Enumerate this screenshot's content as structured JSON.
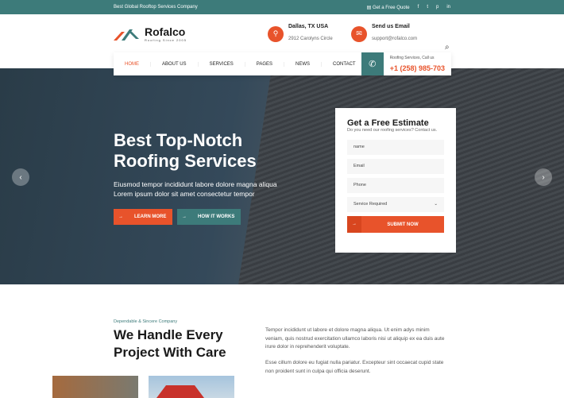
{
  "topbar": {
    "tagline": "Best Global Rooftop Services Company",
    "quote": "Get a Free Quote",
    "social": [
      "f",
      "t",
      "p",
      "in"
    ]
  },
  "logo": {
    "name": "Rofalco",
    "tag": "Roofing Since 2005"
  },
  "header": {
    "location_title": "Dallas, TX USA",
    "location_sub": "2912 Carolyns Circle",
    "email_title": "Send us Email",
    "email_sub": "support@rofalco.com"
  },
  "nav": {
    "items": [
      "HOME",
      "ABOUT US",
      "SERVICES",
      "PAGES",
      "NEWS",
      "CONTACT"
    ],
    "phone_label": "Roofing Services, Call us",
    "phone": "+1 (258) 985-703"
  },
  "hero": {
    "title": "Best Top-Notch Roofing Services",
    "text": "Eiusmod tempor incididunt labore dolore magna aliqua Lorem ipsum dolor sit amet consectetur tempor",
    "btn1": "LEARN MORE",
    "btn2": "HOW IT WORKS"
  },
  "form": {
    "title": "Get a Free Estimate",
    "subtitle": "Do you need our roofing services? Contact us.",
    "name": "name",
    "email": "Email",
    "phone": "Phone",
    "service": "Service Required",
    "submit": "SUBMIT NOW"
  },
  "about": {
    "kicker": "Dependable & Sincere Company",
    "title": "We Handle Every Project With Care",
    "p1": "Tempor incididunt ut labore et dolore magna aliqua. Ut enim adys minim veniam, quis nostrud exercitation ullamco laboris nisi ut aliquip ex ea duis aute irure dolor in reprehenderit voluptate.",
    "p2": "Esse cillum dolore eu fugiat nulla pariatur. Excepteur sint occaecat cupid state non proident sunt in culpa qui officia deserunt."
  },
  "colors": {
    "teal": "#3d7b7a",
    "orange": "#e8532b"
  }
}
